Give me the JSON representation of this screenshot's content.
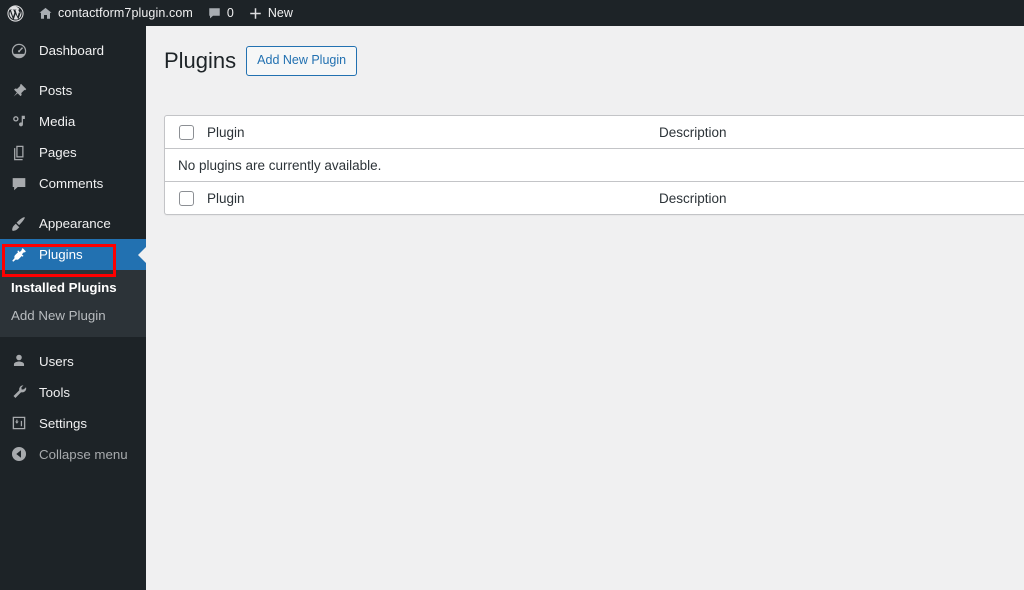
{
  "adminbar": {
    "wp_logo_icon": "wordpress-logo-icon",
    "home_icon": "home-icon",
    "site_name": "contactform7plugin.com",
    "comments_icon": "comment-bubble-icon",
    "comments_count": "0",
    "new_icon": "plus-icon",
    "new_label": "New"
  },
  "sidebar": {
    "items": [
      {
        "label": "Dashboard",
        "icon": "dashboard-gauge-icon",
        "current": false
      },
      {
        "label": "Posts",
        "icon": "pin-icon",
        "current": false
      },
      {
        "label": "Media",
        "icon": "media-music-icon",
        "current": false
      },
      {
        "label": "Pages",
        "icon": "pages-icon",
        "current": false
      },
      {
        "label": "Comments",
        "icon": "comment-bubble-icon",
        "current": false
      },
      {
        "label": "Appearance",
        "icon": "paintbrush-icon",
        "current": false
      },
      {
        "label": "Plugins",
        "icon": "plug-icon",
        "current": true
      },
      {
        "label": "Users",
        "icon": "user-icon",
        "current": false
      },
      {
        "label": "Tools",
        "icon": "wrench-icon",
        "current": false
      },
      {
        "label": "Settings",
        "icon": "settings-sliders-icon",
        "current": false
      }
    ],
    "submenu": [
      {
        "label": "Installed Plugins",
        "current": true
      },
      {
        "label": "Add New Plugin",
        "current": false
      }
    ],
    "collapse_label": "Collapse menu",
    "collapse_icon": "chevron-left-circle-icon"
  },
  "main": {
    "page_title": "Plugins",
    "add_new_button": "Add New Plugin",
    "table": {
      "columns": [
        "Plugin",
        "Description"
      ],
      "empty_message": "No plugins are currently available.",
      "rows": []
    }
  },
  "annotation": {
    "color": "#ff0000",
    "target": "Plugins"
  },
  "colors": {
    "admin_blue": "#2271b1",
    "sidebar_dark": "#1d2327",
    "submenu_dark": "#2c3338",
    "content_bg": "#f0f0f1",
    "annotation_red": "#ff0000"
  }
}
